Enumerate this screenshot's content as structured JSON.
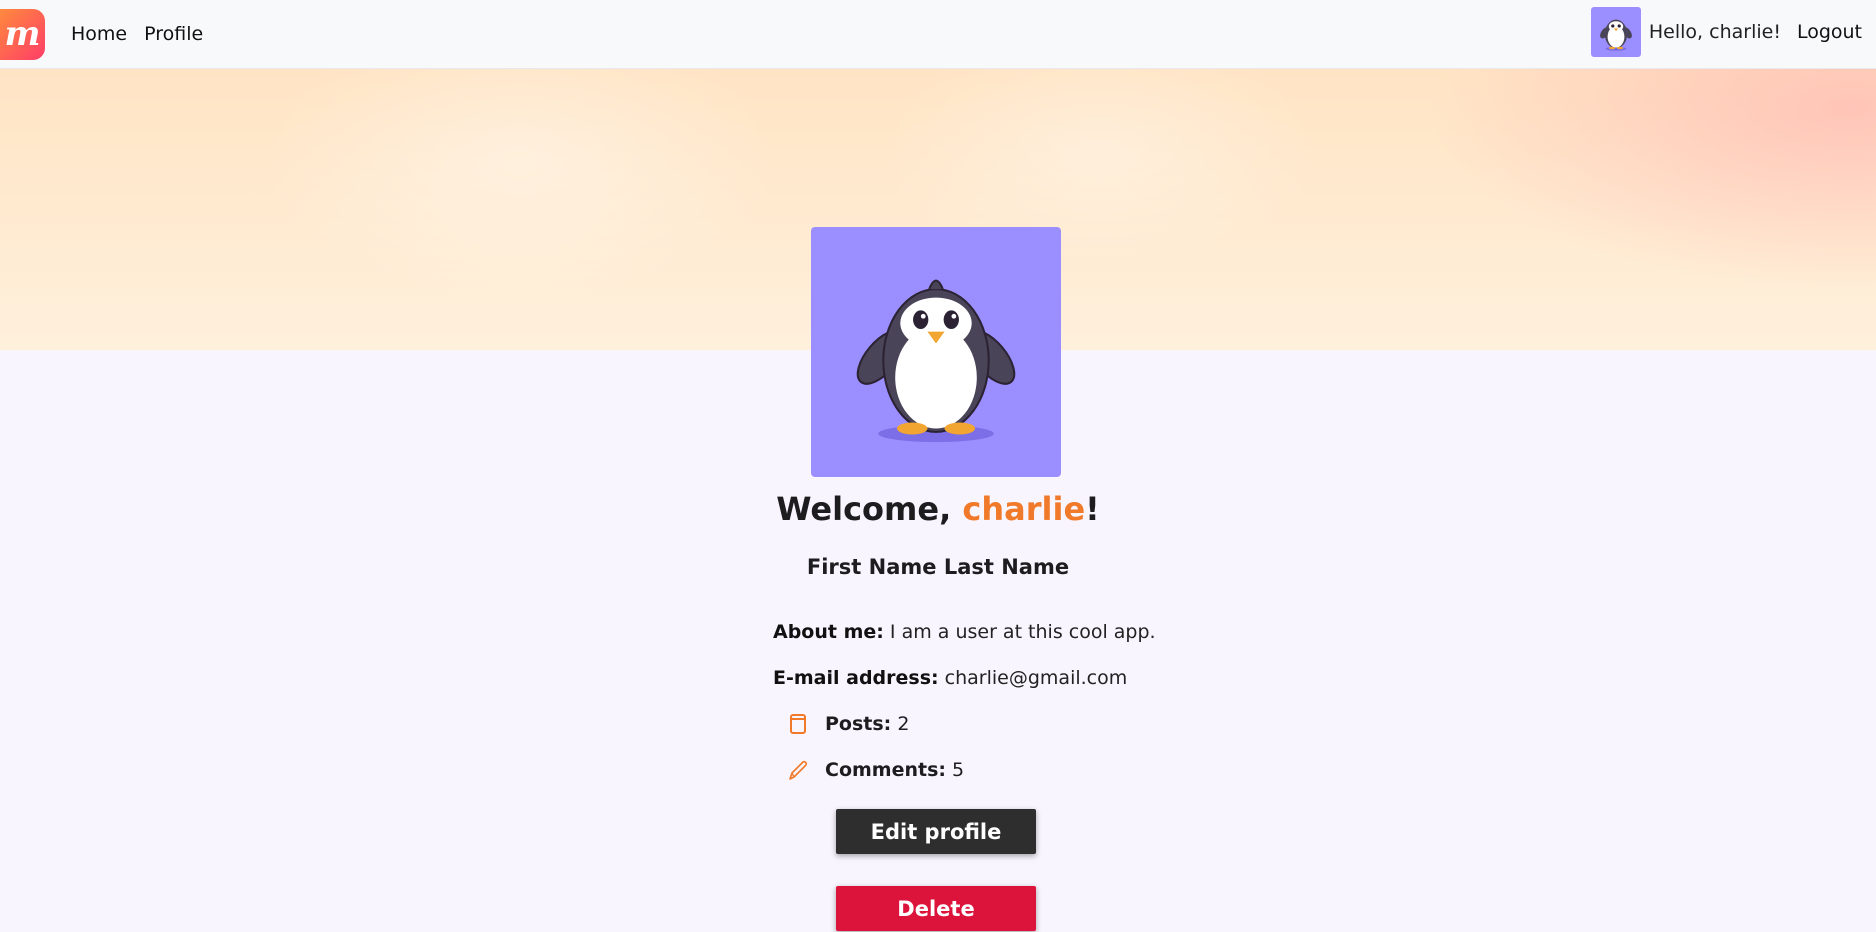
{
  "nav": {
    "logo_letter": "m",
    "links": [
      "Home",
      "Profile"
    ],
    "greeting": "Hello, charlie!",
    "logout": "Logout"
  },
  "profile": {
    "welcome_prefix": "Welcome, ",
    "username": "charlie",
    "welcome_suffix": "!",
    "full_name": "First Name Last Name",
    "about_label": "About me:",
    "about_value": "I am a user at this cool app.",
    "email_label": "E-mail address:",
    "email_value": "charlie@gmail.com",
    "posts_label": "Posts:",
    "posts_value": "2",
    "comments_label": "Comments:",
    "comments_value": "5"
  },
  "actions": {
    "edit": "Edit profile",
    "delete": "Delete"
  },
  "colors": {
    "accent": "#f07a2a",
    "avatar_bg": "#9b8fff",
    "delete": "#dc143c",
    "edit": "#2e2e2e"
  },
  "icons": {
    "posts": "document-icon",
    "comments": "pencil-icon",
    "avatar": "penguin-avatar"
  }
}
